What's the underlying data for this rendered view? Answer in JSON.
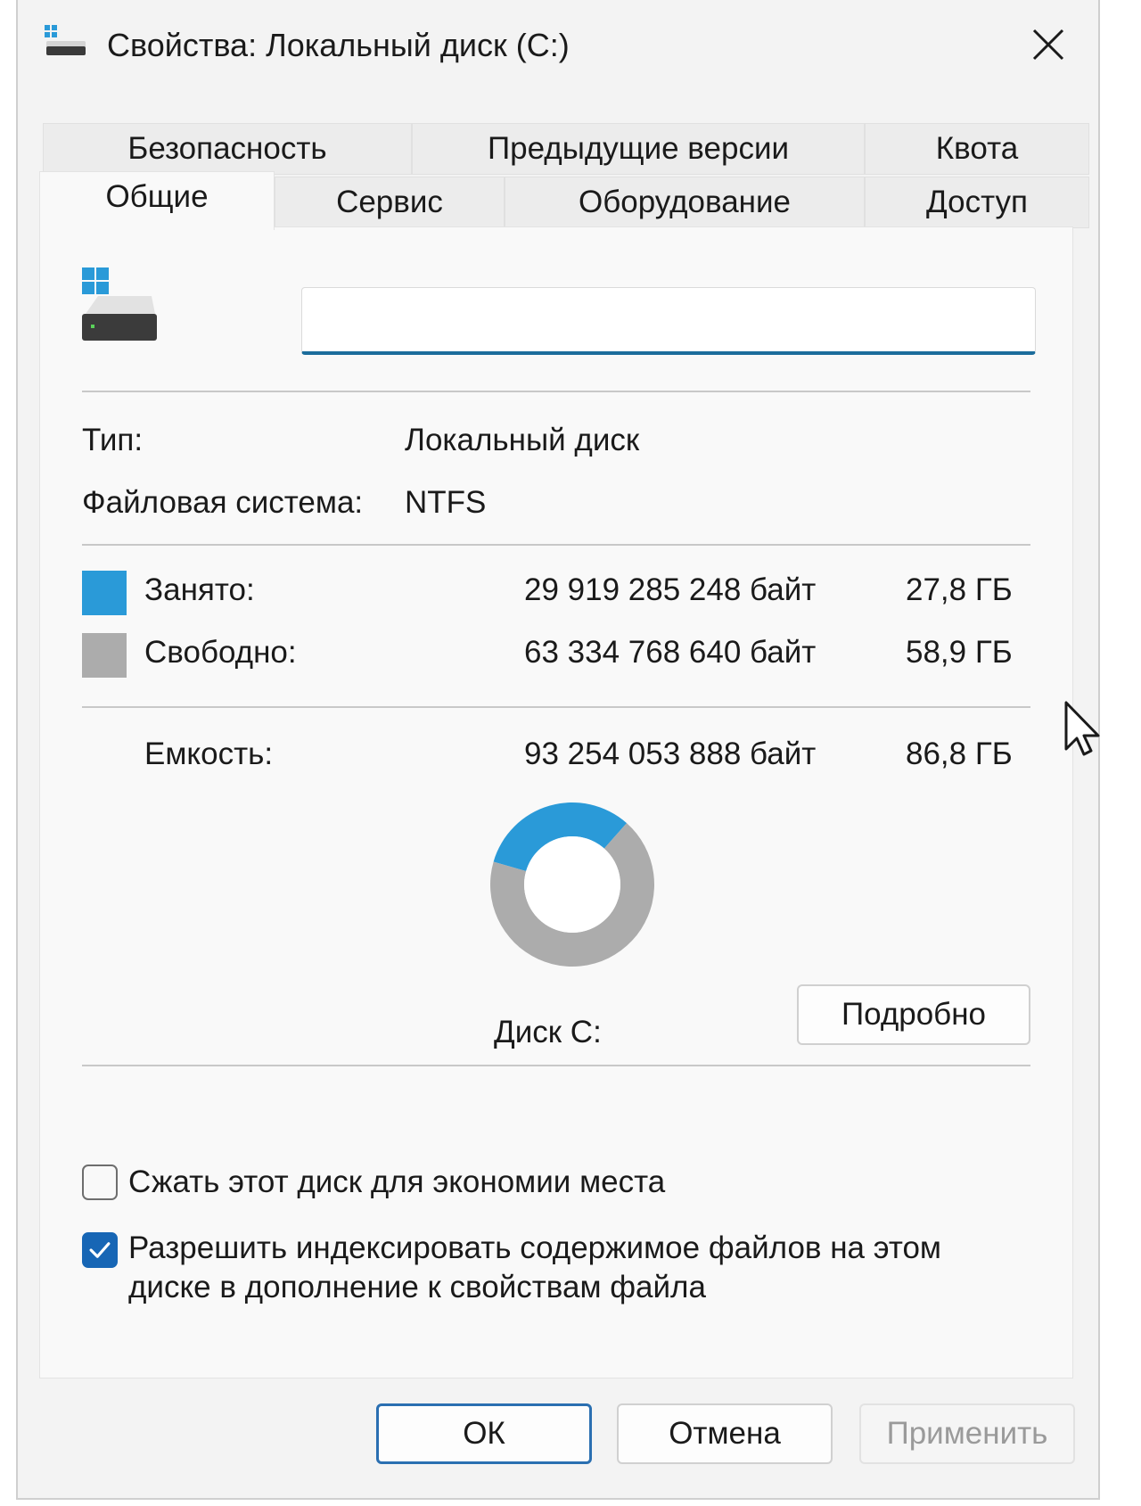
{
  "window": {
    "title": "Свойства: Локальный диск (C:)",
    "close_icon": "close-icon"
  },
  "tabs": {
    "row1": [
      {
        "label": "Безопасность"
      },
      {
        "label": "Предыдущие версии"
      },
      {
        "label": "Квота"
      }
    ],
    "row2": [
      {
        "label": "Общие",
        "active": true
      },
      {
        "label": "Сервис"
      },
      {
        "label": "Оборудование"
      },
      {
        "label": "Доступ"
      }
    ]
  },
  "general": {
    "drive_icon": "windows-drive-icon",
    "volume_label_value": "",
    "type_label": "Тип:",
    "type_value": "Локальный диск",
    "fs_label": "Файловая система:",
    "fs_value": "NTFS",
    "used": {
      "label": "Занято:",
      "bytes": "29 919 285 248 байт",
      "size": "27,8 ГБ",
      "color": "#2a9ad8"
    },
    "free": {
      "label": "Свободно:",
      "bytes": "63 334 768 640 байт",
      "size": "58,9 ГБ",
      "color": "#acacac"
    },
    "capacity": {
      "label": "Емкость:",
      "bytes": "93 254 053 888 байт",
      "size": "86,8 ГБ"
    },
    "disk_label": "Диск C:",
    "details_button": "Подробно",
    "compress_label": "Сжать этот диск для экономии места",
    "compress_checked": false,
    "index_label_line1": "Разрешить индексировать содержимое файлов на этом",
    "index_label_line2": "диске в дополнение к свойствам файла",
    "index_checked": true
  },
  "chart_data": {
    "type": "pie",
    "categories": [
      "Занято",
      "Свободно"
    ],
    "values": [
      27.8,
      58.9
    ],
    "colors": [
      "#2a9ad8",
      "#acacac"
    ],
    "donut": true
  },
  "footer": {
    "ok": "ОК",
    "cancel": "Отмена",
    "apply": "Применить"
  }
}
